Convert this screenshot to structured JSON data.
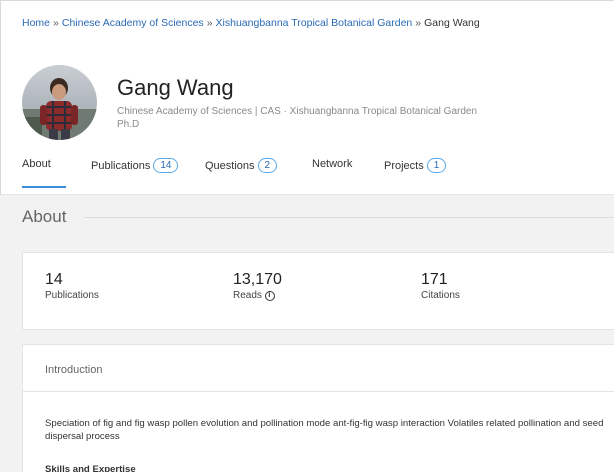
{
  "breadcrumb": {
    "items": [
      "Home",
      "Chinese Academy of Sciences",
      "Xishuangbanna Tropical Botanical Garden"
    ],
    "current": "Gang Wang",
    "separator": "»"
  },
  "profile": {
    "name": "Gang Wang",
    "affiliation": "Chinese Academy of Sciences | CAS · Xishuangbanna Tropical Botanical Garden",
    "degree": "Ph.D"
  },
  "tabs": [
    {
      "label": "About",
      "count": null
    },
    {
      "label": "Publications",
      "count": "14"
    },
    {
      "label": "Questions",
      "count": "2"
    },
    {
      "label": "Network",
      "count": null
    },
    {
      "label": "Projects",
      "count": "1"
    }
  ],
  "about": {
    "title": "About",
    "stats": [
      {
        "value": "14",
        "label": "Publications"
      },
      {
        "value": "13,170",
        "label": "Reads"
      },
      {
        "value": "171",
        "label": "Citations"
      }
    ]
  },
  "introduction": {
    "heading": "Introduction",
    "text": "Speciation of fig and fig wasp pollen evolution and pollination mode ant-fig-fig wasp interaction Volatiles related pollination and seed dispersal process",
    "skills_heading": "Skills and Expertise"
  },
  "colors": {
    "link": "#2a6ab5",
    "accent": "#3a8ed8",
    "badge_border": "#5aa9e6",
    "band": "#f2f2f2"
  }
}
